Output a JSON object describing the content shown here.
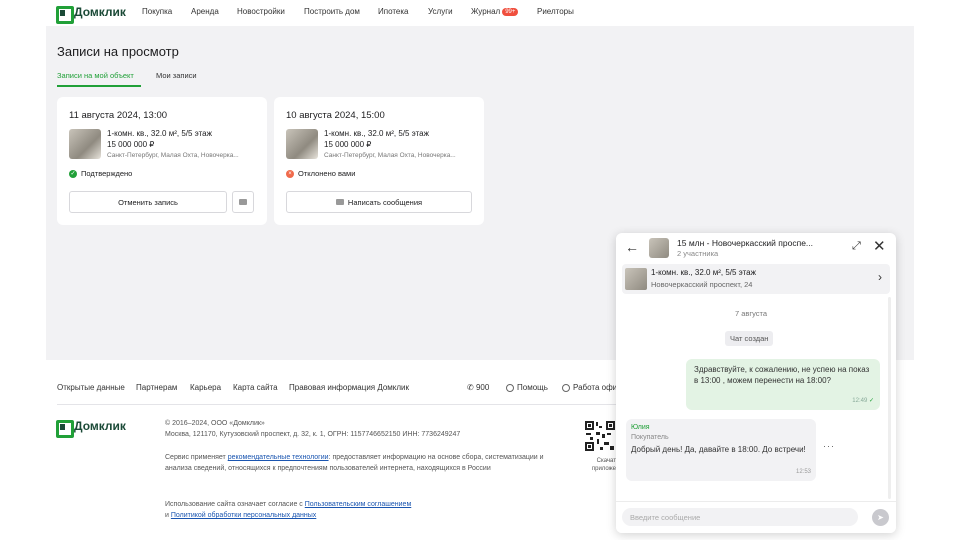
{
  "nav": {
    "logo": "Домклик",
    "items": [
      "Покупка",
      "Аренда",
      "Новостройки",
      "Построить дом",
      "Ипотека",
      "Услуги",
      "Журнал",
      "Риелторы"
    ],
    "journal_badge": "99+"
  },
  "page": {
    "title": "Записи на просмотр",
    "tabs": [
      "Записи на мой объект",
      "Мои записи"
    ]
  },
  "cards": [
    {
      "date": "11 августа 2024, 13:00",
      "apartment": "1-комн. кв., 32.0 м², 5/5 этаж",
      "price": "15 000 000 ₽",
      "address": "Санкт-Петербург, Малая Охта, Новочерка...",
      "status": "Подтверждено",
      "status_color": "#21a038",
      "button": "Отменить запись"
    },
    {
      "date": "10 августа 2024, 15:00",
      "apartment": "1-комн. кв., 32.0 м², 5/5 этаж",
      "price": "15 000 000 ₽",
      "address": "Санкт-Петербург, Малая Охта, Новочерка...",
      "status": "Отклонено вами",
      "status_color": "#f06a4b",
      "button": "Написать сообщения"
    }
  ],
  "footer": {
    "links": [
      "Открытые данные",
      "Партнерам",
      "Карьера",
      "Карта сайта",
      "Правовая информация Домклик"
    ],
    "phone": "900",
    "help": "Помощь",
    "hours": "Работа офи",
    "logo": "Домклик",
    "copyright": "© 2016–2024, ООО «Домклик»",
    "legal": "Москва, 121170, Кутузовский проспект, д. 32, к. 1, ОГРН: 1157746652150 ИНН: 7736249247",
    "tech_pre": "Сервис применяет ",
    "tech_link": "рекомендательные технологии",
    "tech_post": ": предоставляет информацию на основе сбора, систематизации и анализа сведений, относящихся к предпочтениям пользователей интернета, находящихся в России",
    "agree_pre": "Использование сайта означает согласие с ",
    "agree_link1": "Пользовательским соглашением",
    "agree_mid": "и ",
    "agree_link2": "Политикой обработки персональных данных",
    "qr_caption1": "Скачат",
    "qr_caption2": "приложе"
  },
  "chat": {
    "title": "15 млн - Новочеркасский проспе...",
    "participants": "2 участника",
    "object_title": "1-комн. кв., 32.0 м², 5/5 этаж",
    "object_address": "Новочеркасский проспект, 24",
    "day": "7 августа",
    "system": "Чат создан",
    "outgoing": {
      "text": "Здравствуйте, к сожалению, не успею на показ в 13:00 , можем перенести на 18:00?",
      "time": "12:49"
    },
    "incoming": {
      "author": "Юлия",
      "role": "Покупатель",
      "text": "Добрый день! Да, давайте в 18:00. До встречи!",
      "time": "12:53"
    },
    "input_placeholder": "Введите сообщение"
  }
}
